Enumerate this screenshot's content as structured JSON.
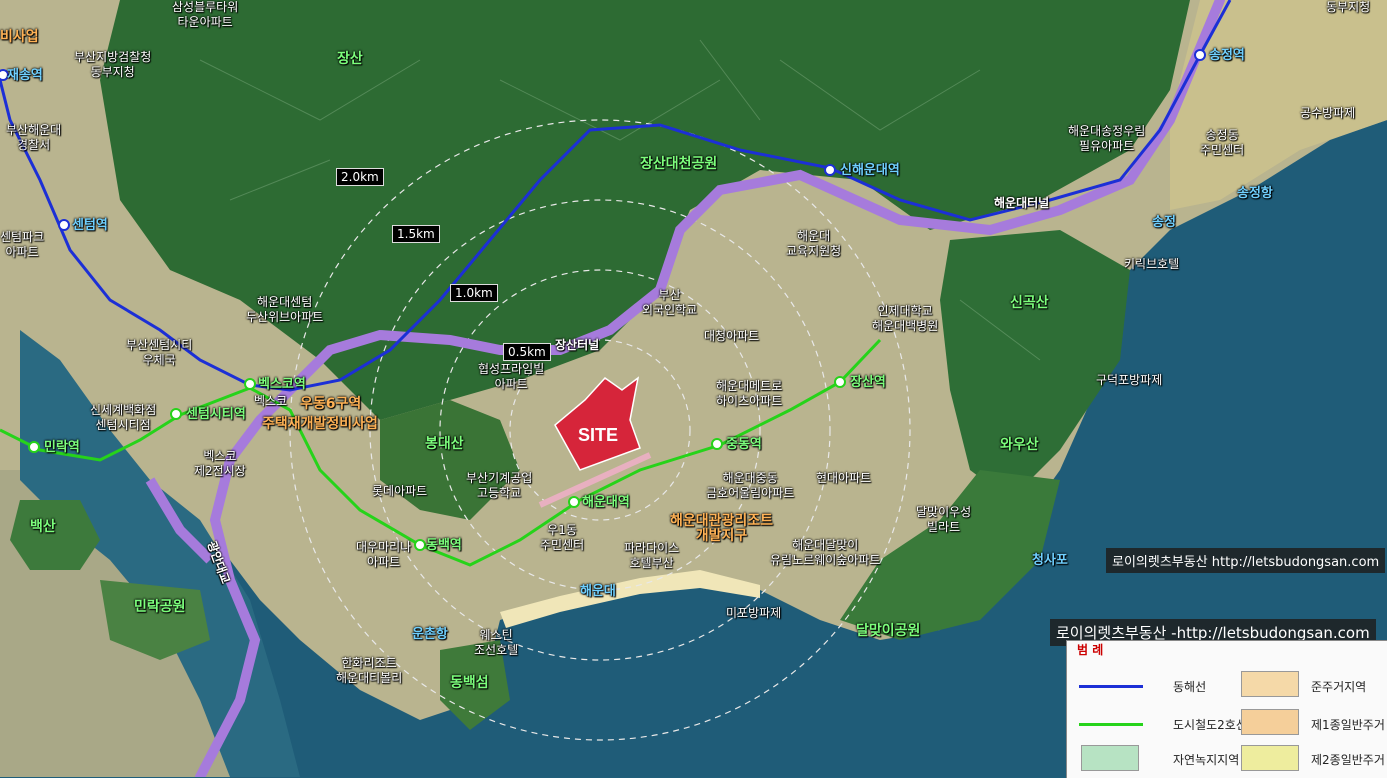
{
  "map": {
    "labels": {
      "jangsan": "장산",
      "jangsan_daecheon_park": "장산대천공원",
      "singoksan": "신곡산",
      "wausan": "와우산",
      "bongdaesan": "봉대산",
      "baeksan": "백산",
      "minrak_park": "민락공원",
      "dongbaekseom": "동백섬",
      "dalmaji_park": "달맞이공원",
      "haeundae": "해운대",
      "songjeong": "송정",
      "cheongsapo": "청사포",
      "songjeong_port": "송정항",
      "jaesong_station": "재송역",
      "centum_station": "센텀역",
      "songjeong_station": "송정역",
      "sinhaeundae_station": "신해운대역",
      "minrak_station": "민락역",
      "centumcity_station": "센텀시티역",
      "bexco_station": "벡스코역",
      "dongbaek_station": "동백역",
      "haeundae_station": "해운대역",
      "jungdong_station": "중동역",
      "jangsan_station": "장산역",
      "haeundae_tunnel": "해운대터널",
      "jangsan_tunnel": "장산터널",
      "gwangan_bridge": "광안대교",
      "udong_area": "우동6구역",
      "redevelopment": "주택재개발정비사업",
      "biz_top": "비사업",
      "tower_apt": "타운아파트",
      "police_branch": "부산지방검찰청\n동부지청",
      "police_station": "부산해운대\n경찰서",
      "centum_park_apt": "센텀파크\n아파트",
      "haeundae_centum": "해운대센텀\n두산위브아파트",
      "centum_post": "부산센텀시티\n우체국",
      "shinsegae": "신세계백화점\n센텀시티점",
      "bexco": "벡스코",
      "bexco2": "벡스코\n제2전시장",
      "lotte_apt": "롯데아파트",
      "daewoo_marina": "대우마리나\n아파트",
      "hanwha": "한화리조트\n해운대티볼리",
      "westin": "웨스틴\n조선호텔",
      "unchon_port": "운촌항",
      "udong_center": "우1동\n주민센터",
      "paradise_hotel": "파라다이스\n호텔부산",
      "mipo": "미포방파제",
      "resort_zone": "해운대관광리조트\n개발지구",
      "dalmaji_apt": "해운대달맞이\n유림노르웨이숲아파트",
      "dalmaji_villa": "달맞이우성\n빌라트",
      "hyundai_apt": "현대아파트",
      "geumho_apt": "해운대중동\n금호어울림아파트",
      "metro_apt": "해운대메트로\n하이츠아파트",
      "daecheong_apt": "대청아파트",
      "foreign_school": "부산\n외국인학교",
      "edu_office": "해운대\n교육지원청",
      "paik_hospital": "인제대학교\n해운대백병원",
      "hyupsung_apt": "협성프라임빌\n아파트",
      "machinery_school": "부산기계공업\n고등학교",
      "kirik_hotel": "키릭브호텔",
      "guduk_breakwater": "구덕포방파제",
      "songjeong_woorim": "해운대송정우림\n필유아파트",
      "songjeong_center": "송정동\n주민센터",
      "air_force": "공수방파제",
      "top_right": "동부지청",
      "top_center": "삼성블루타워\n타운아파트"
    },
    "distances": [
      "2.0km",
      "1.5km",
      "1.0km",
      "0.5km"
    ],
    "site_label": "SITE",
    "watermarks": [
      "로이의렛츠부동산 http://letsbudongsan.com",
      "로이의렛츠부동산 -http://letsbudongsan.com"
    ],
    "colors": {
      "donghae_line": "#1c2fd6",
      "metro_line2": "#26d31a",
      "tunnel_road": "#a67bdc",
      "site": "#d6253a"
    }
  },
  "legend": {
    "title": "범 례",
    "items": [
      "동해선",
      "도시철도2호선",
      "자연녹지지역",
      "준주거지역",
      "제1종일반주거",
      "제2종일반주거"
    ],
    "colors": {
      "nature": "#b7e3c3",
      "semi_res": "#f5d9a8",
      "res1": "#f5cf9a",
      "res2": "#eeed9e"
    }
  }
}
